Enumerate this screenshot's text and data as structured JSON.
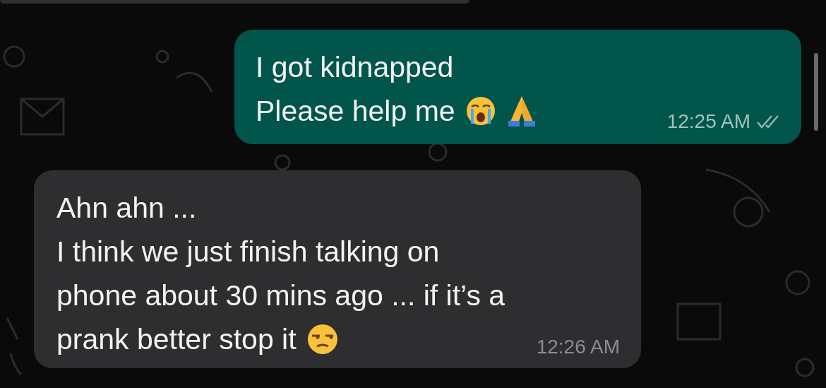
{
  "messages": [
    {
      "kind": "outgoing",
      "time": "12:25 AM",
      "read": false,
      "lines": [
        [
          {
            "kind": "text",
            "text": "I got kidnapped"
          }
        ],
        [
          {
            "kind": "text",
            "text": "Please help me"
          },
          {
            "kind": "crying-face"
          },
          {
            "kind": "praying-hands"
          }
        ]
      ]
    },
    {
      "kind": "incoming",
      "time": "12:26 AM",
      "lines": [
        [
          {
            "kind": "text",
            "text": "Ahn ahn ..."
          }
        ],
        [
          {
            "kind": "text",
            "text": "I think we just finish talking on"
          }
        ],
        [
          {
            "kind": "text",
            "text": "phone about 30 mins ago ... if it’s a"
          }
        ],
        [
          {
            "kind": "text",
            "text": "prank better stop it"
          },
          {
            "kind": "unamused-face"
          }
        ]
      ]
    }
  ]
}
